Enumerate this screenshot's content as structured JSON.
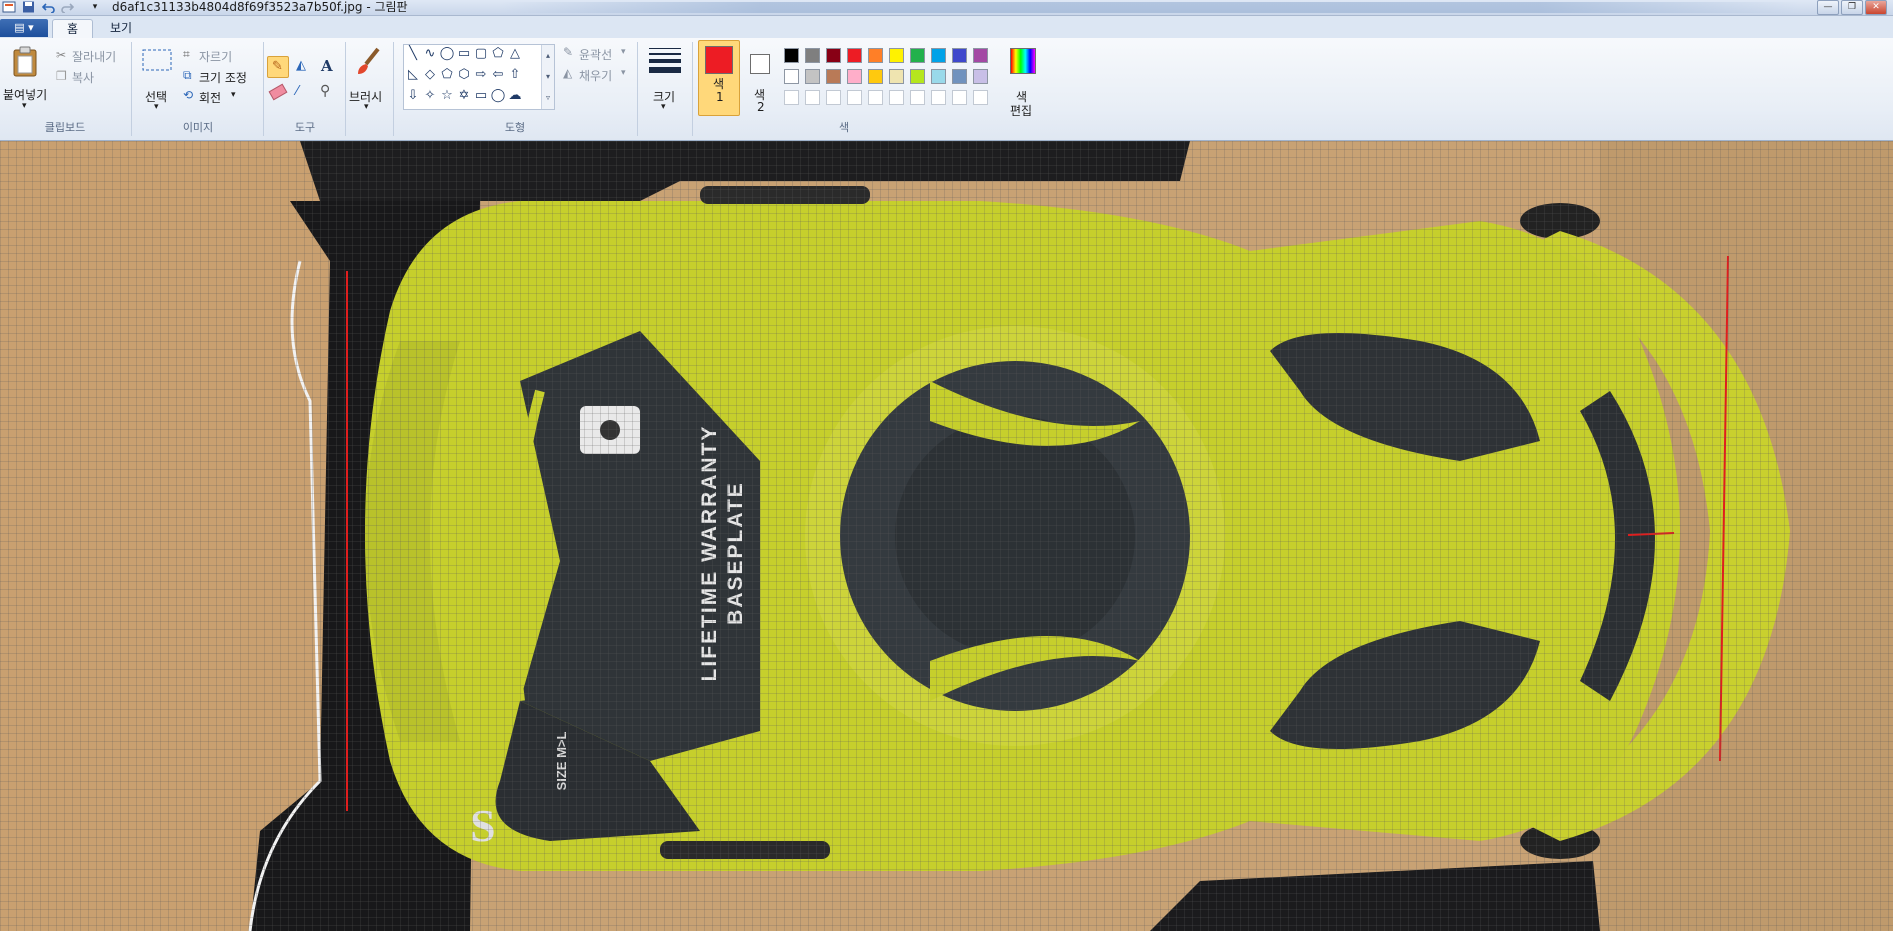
{
  "window": {
    "title": "d6af1c31133b4804d8f69f3523a7b50f.jpg - 그림판"
  },
  "tabs": {
    "file_menu": "▤ ▾",
    "home": "홈",
    "view": "보기"
  },
  "clipboard": {
    "paste": "붙여넣기",
    "cut": "잘라내기",
    "copy": "복사",
    "group": "클립보드"
  },
  "image": {
    "select": "선택",
    "crop": "자르기",
    "resize": "크기 조정",
    "rotate": "회전",
    "group": "이미지"
  },
  "tools": {
    "group": "도구"
  },
  "brushes": {
    "label": "브러시"
  },
  "shapes": {
    "outline": "윤곽선",
    "fill": "채우기",
    "group": "도형"
  },
  "size": {
    "label": "크기"
  },
  "colors": {
    "color1_line1": "색",
    "color1_line2": "1",
    "color2_line1": "색",
    "color2_line2": "2",
    "edit_line1": "색",
    "edit_line2": "편집",
    "group": "색",
    "color1_value": "#ed1c24",
    "color2_value": "#ffffff",
    "palette_row1": [
      "#000000",
      "#7f7f7f",
      "#880015",
      "#ed1c24",
      "#ff7f27",
      "#fff200",
      "#22b14c",
      "#00a2e8",
      "#3f48cc",
      "#a349a4"
    ],
    "palette_row2": [
      "#ffffff",
      "#c3c3c3",
      "#b97a57",
      "#ffaec9",
      "#ffc90e",
      "#efe4b0",
      "#b5e61d",
      "#99d9ea",
      "#7092be",
      "#c8bfe7"
    ]
  },
  "photo_text": {
    "warranty_line1": "LIFETIME WARRANTY",
    "warranty_line2": "BASEPLATE",
    "size_mark": "SIZE M>L",
    "s_mark": "S"
  }
}
